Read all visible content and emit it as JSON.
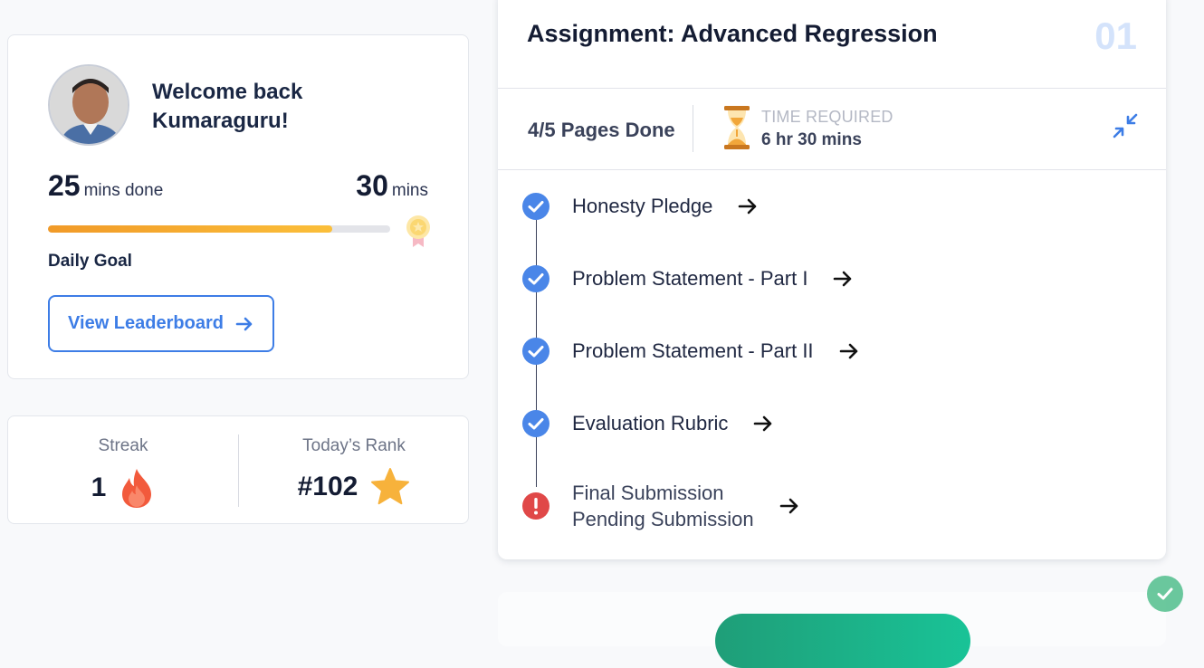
{
  "welcome": {
    "greeting": "Welcome back",
    "name": "Kumaraguru!",
    "mins_done": "25",
    "mins_done_unit": "mins done",
    "mins_goal": "30",
    "mins_goal_unit": "mins",
    "progress_fraction": 0.83,
    "daily_goal_label": "Daily Goal",
    "leaderboard_button": "View Leaderboard"
  },
  "stats": {
    "streak_label": "Streak",
    "streak_value": "1",
    "rank_label": "Today’s Rank",
    "rank_value": "#102"
  },
  "assignment": {
    "title": "Assignment: Advanced Regression",
    "number": "01",
    "pages_done": "4/5 Pages Done",
    "time_label": "TIME REQUIRED",
    "time_value": "6 hr 30 mins",
    "steps": [
      {
        "label": "Honesty Pledge",
        "status": "done"
      },
      {
        "label": "Problem Statement - Part I",
        "status": "done"
      },
      {
        "label": "Problem Statement - Part II",
        "status": "done"
      },
      {
        "label": "Evaluation Rubric",
        "status": "done"
      },
      {
        "label": "Final Submission",
        "sublabel": "Pending Submission",
        "status": "pending"
      }
    ]
  },
  "colors": {
    "accent": "#3d7de6",
    "progress_start": "#f19a28",
    "progress_end": "#fbbf3a",
    "done": "#4a86e8",
    "pending": "#e04848"
  }
}
